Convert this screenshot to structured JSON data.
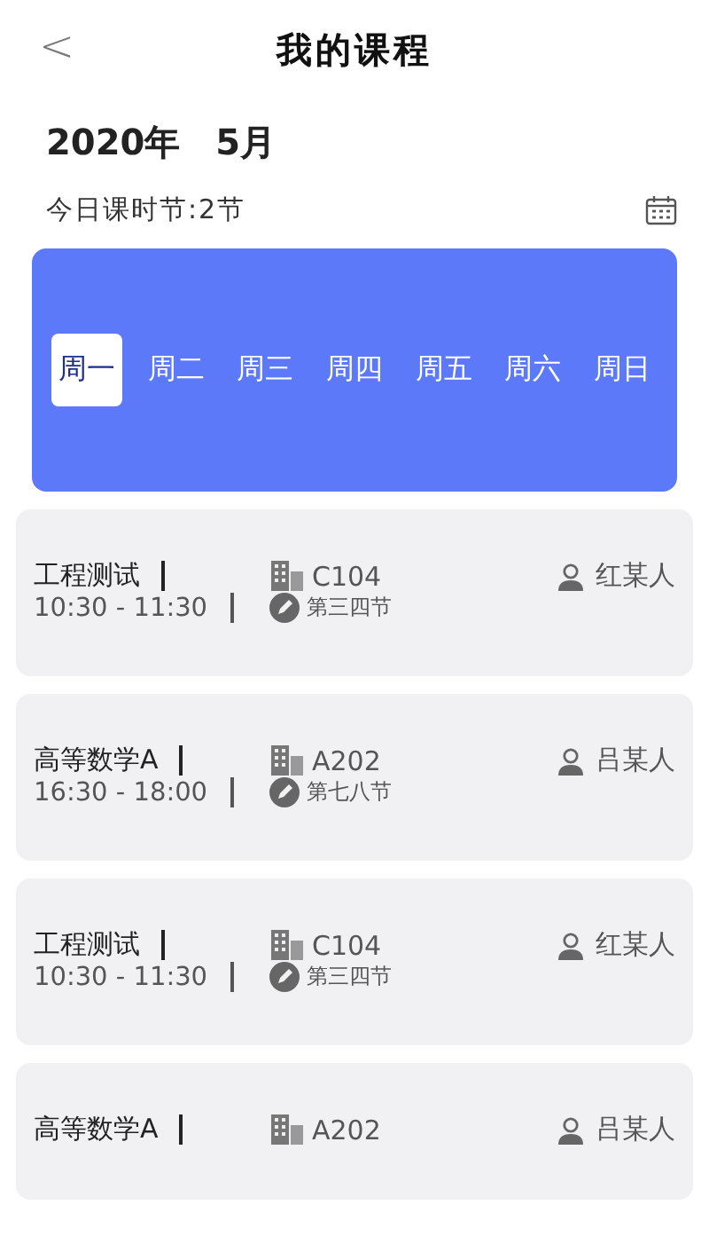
{
  "header": {
    "back": "<",
    "title": "我的课程"
  },
  "date": {
    "year": "2020年",
    "month": "5月"
  },
  "today": {
    "label": "今日课时节:2节"
  },
  "weekdays": [
    {
      "label": "周一",
      "selected": true
    },
    {
      "label": "周二",
      "selected": false
    },
    {
      "label": "周三",
      "selected": false
    },
    {
      "label": "周四",
      "selected": false
    },
    {
      "label": "周五",
      "selected": false
    },
    {
      "label": "周六",
      "selected": false
    },
    {
      "label": "周日",
      "selected": false
    }
  ],
  "courses": [
    {
      "name": "工程测试",
      "room": "C104",
      "teacher": "红某人",
      "time": "10:30 - 11:30",
      "period": "第三四节"
    },
    {
      "name": "高等数学A",
      "room": "A202",
      "teacher": "吕某人",
      "time": "16:30 - 18:00",
      "period": "第七八节"
    },
    {
      "name": "工程测试",
      "room": "C104",
      "teacher": "红某人",
      "time": "10:30 - 11:30",
      "period": "第三四节"
    },
    {
      "name": "高等数学A",
      "room": "A202",
      "teacher": "吕某人"
    }
  ]
}
